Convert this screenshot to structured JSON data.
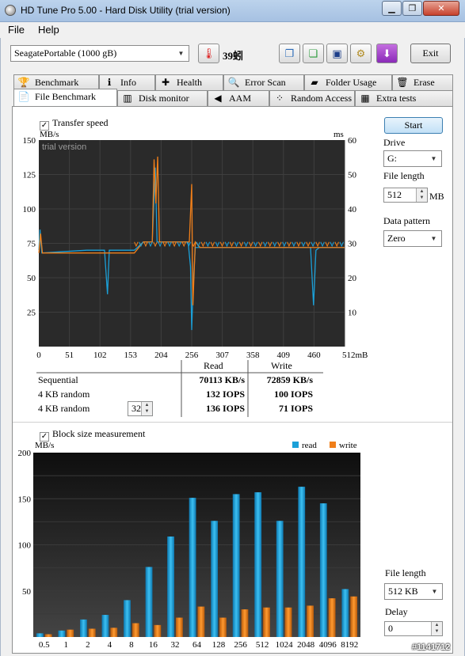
{
  "window": {
    "title": "HD Tune Pro 5.00 - Hard Disk Utility (trial version)",
    "minimize": "▁",
    "maximize": "❐",
    "close": "✕"
  },
  "menu": {
    "file": "File",
    "help": "Help"
  },
  "toolbar": {
    "drive": "SeagatePortable (1000 gB)",
    "temperature": "39",
    "temp_unit": "蚓",
    "exit_label": "Exit",
    "icons": [
      "copy-icon",
      "copy-all-icon",
      "save-icon",
      "options-icon",
      "download-icon"
    ]
  },
  "tabs_row1": [
    {
      "label": "Benchmark",
      "icon": "benchmark-icon",
      "glyph": "🏆"
    },
    {
      "label": "Info",
      "icon": "info-icon",
      "glyph": "ℹ"
    },
    {
      "label": "Health",
      "icon": "health-icon",
      "glyph": "✚"
    },
    {
      "label": "Error Scan",
      "icon": "error-scan-icon",
      "glyph": "🔍"
    },
    {
      "label": "Folder Usage",
      "icon": "folder-icon",
      "glyph": "▰"
    },
    {
      "label": "Erase",
      "icon": "trash-icon",
      "glyph": "🗑"
    }
  ],
  "tabs_row2": [
    {
      "label": "File Benchmark",
      "icon": "file-benchmark-icon",
      "glyph": "📄"
    },
    {
      "label": "Disk monitor",
      "icon": "disk-monitor-icon",
      "glyph": "▥"
    },
    {
      "label": "AAM",
      "icon": "speaker-icon",
      "glyph": "◀"
    },
    {
      "label": "Random Access",
      "icon": "random-access-icon",
      "glyph": "⁘"
    },
    {
      "label": "Extra tests",
      "icon": "extra-tests-icon",
      "glyph": "▦"
    }
  ],
  "transfer": {
    "checkbox_label": "Transfer speed",
    "checked": true,
    "left_unit": "MB/s",
    "right_unit": "ms",
    "watermark": "trial version",
    "y_ticks": [
      "150",
      "125",
      "100",
      "75",
      "50",
      "25"
    ],
    "y2_ticks": [
      "60",
      "50",
      "40",
      "30",
      "20",
      "10"
    ],
    "x_ticks": [
      "0",
      "51",
      "102",
      "153",
      "204",
      "256",
      "307",
      "358",
      "409",
      "460",
      "512mB"
    ]
  },
  "results": {
    "col_read": "Read",
    "col_write": "Write",
    "rows": [
      {
        "label": "Sequential",
        "read": "70113 KB/s",
        "write": "72859 KB/s"
      },
      {
        "label": "4 KB random",
        "read": "132 IOPS",
        "write": "100 IOPS"
      },
      {
        "label": "4 KB random",
        "read": "136 IOPS",
        "write": "71 IOPS"
      }
    ],
    "queue_depth": "32"
  },
  "block": {
    "checkbox_label": "Block size measurement",
    "checked": true,
    "unit": "MB/s",
    "legend_read": "read",
    "legend_write": "write",
    "y_ticks": [
      "200",
      "150",
      "100",
      "50"
    ],
    "x_ticks": [
      "0.5",
      "1",
      "2",
      "4",
      "8",
      "16",
      "32",
      "64",
      "128",
      "256",
      "512",
      "1024",
      "2048",
      "4096",
      "8192"
    ]
  },
  "side": {
    "start_label": "Start",
    "drive_label": "Drive",
    "drive_value": "G:",
    "file_length_label": "File length",
    "file_length_value": "512",
    "file_length_unit": "MB",
    "pattern_label": "Data pattern",
    "pattern_value": "Zero",
    "block_file_length_label": "File length",
    "block_file_length_value": "512 KB",
    "delay_label": "Delay",
    "delay_value": "0"
  },
  "watermark_id": "#1141712",
  "colors": {
    "read": "#1ba0d8",
    "write": "#f07f1a",
    "plot_bg": "#2a2a2a",
    "grid": "#3e3e3e"
  },
  "chart_data": [
    {
      "type": "line",
      "title": "Transfer speed",
      "xlabel": "",
      "ylabel": "MB/s",
      "xlim": [
        0,
        512
      ],
      "ylim": [
        0,
        150
      ],
      "y2lim": [
        0,
        60
      ],
      "series": [
        {
          "name": "read",
          "x": [
            0,
            2,
            5,
            80,
            110,
            115,
            118,
            160,
            175,
            190,
            195,
            198,
            200,
            202,
            206,
            230,
            250,
            254,
            256,
            258,
            262,
            300,
            400,
            455,
            460,
            464,
            470,
            512
          ],
          "values": [
            70,
            85,
            68,
            70,
            70,
            38,
            70,
            70,
            76,
            76,
            130,
            76,
            76,
            76,
            76,
            76,
            76,
            58,
            12,
            40,
            72,
            72,
            72,
            72,
            30,
            70,
            72,
            72
          ]
        },
        {
          "name": "write",
          "x": [
            0,
            3,
            6,
            150,
            160,
            175,
            190,
            193,
            196,
            199,
            202,
            205,
            230,
            252,
            256,
            258,
            262,
            270,
            300,
            400,
            440,
            512
          ],
          "values": [
            68,
            82,
            68,
            68,
            68,
            76,
            76,
            136,
            104,
            138,
            76,
            76,
            76,
            76,
            118,
            30,
            76,
            72,
            72,
            72,
            72,
            72
          ]
        }
      ]
    },
    {
      "type": "bar",
      "title": "Block size measurement",
      "xlabel": "",
      "ylabel": "MB/s",
      "ylim": [
        0,
        200
      ],
      "categories": [
        "0.5",
        "1",
        "2",
        "4",
        "8",
        "16",
        "32",
        "64",
        "128",
        "256",
        "512",
        "1024",
        "2048",
        "4096",
        "8192"
      ],
      "series": [
        {
          "name": "read",
          "values": [
            4,
            7,
            19,
            24,
            40,
            76,
            109,
            151,
            126,
            155,
            157,
            126,
            163,
            145,
            52
          ]
        },
        {
          "name": "write",
          "values": [
            3,
            8,
            9,
            10,
            15,
            13,
            21,
            33,
            21,
            30,
            32,
            32,
            34,
            42,
            44
          ]
        }
      ]
    }
  ]
}
